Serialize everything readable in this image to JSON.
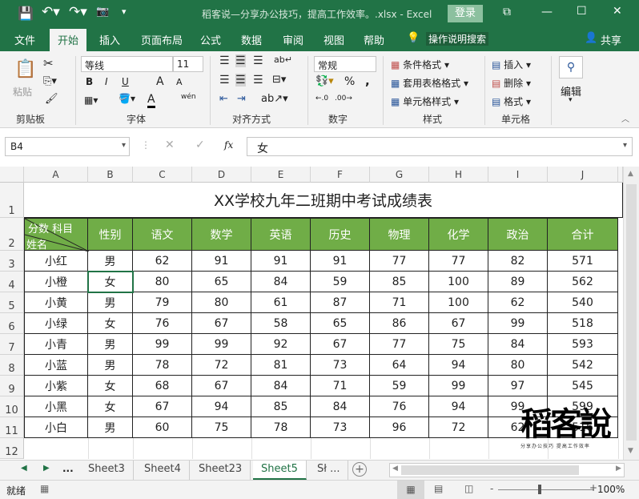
{
  "titlebar": {
    "title": "稻客说—分享办公技巧，提高工作效率。.xlsx  -  Excel",
    "login": "登录",
    "minimize": "—",
    "maximize": "☐",
    "close": "✕",
    "restore": "⧉"
  },
  "menu": {
    "tabs": [
      "文件",
      "开始",
      "插入",
      "页面布局",
      "公式",
      "数据",
      "审阅",
      "视图",
      "帮助"
    ],
    "search": "操作说明搜索",
    "share": "共享"
  },
  "ribbon": {
    "clipboard": {
      "paste": "粘贴",
      "label": "剪贴板"
    },
    "font": {
      "name": "等线",
      "size": "11",
      "bold": "B",
      "italic": "I",
      "underline": "U",
      "label": "字体",
      "grow": "A",
      "shrink": "A",
      "font_color": "A",
      "phonetic": "wén"
    },
    "alignment": {
      "label": "对齐方式"
    },
    "number": {
      "format": "常规",
      "percent": "%",
      "comma": ",",
      "label": "数字"
    },
    "styles": {
      "conditional": "条件格式",
      "table": "套用表格格式",
      "cell": "单元格样式",
      "label": "样式"
    },
    "cells": {
      "insert": "插入",
      "delete": "删除",
      "format": "格式",
      "label": "单元格"
    },
    "editing": {
      "label": "编辑"
    }
  },
  "formula_bar": {
    "name_box": "B4",
    "fx": "fx",
    "value": "女"
  },
  "columns": [
    "A",
    "B",
    "C",
    "D",
    "E",
    "F",
    "G",
    "H",
    "I",
    "J"
  ],
  "rows": [
    "1",
    "2",
    "3",
    "4",
    "5",
    "6",
    "7",
    "8",
    "9",
    "10",
    "11",
    "12"
  ],
  "table": {
    "title": "XX学校九年二班期中考试成绩表",
    "corner": {
      "subject": "分数  科目",
      "name": "姓名"
    },
    "headers": [
      "性别",
      "语文",
      "数学",
      "英语",
      "历史",
      "物理",
      "化学",
      "政治",
      "合计"
    ],
    "data": [
      [
        "小红",
        "男",
        "62",
        "91",
        "91",
        "91",
        "77",
        "77",
        "82",
        "571"
      ],
      [
        "小橙",
        "女",
        "80",
        "65",
        "84",
        "59",
        "85",
        "100",
        "89",
        "562"
      ],
      [
        "小黄",
        "男",
        "79",
        "80",
        "61",
        "87",
        "71",
        "100",
        "62",
        "540"
      ],
      [
        "小绿",
        "女",
        "76",
        "67",
        "58",
        "65",
        "86",
        "67",
        "99",
        "518"
      ],
      [
        "小青",
        "男",
        "99",
        "99",
        "92",
        "67",
        "77",
        "75",
        "84",
        "593"
      ],
      [
        "小蓝",
        "男",
        "78",
        "72",
        "81",
        "73",
        "64",
        "94",
        "80",
        "542"
      ],
      [
        "小紫",
        "女",
        "68",
        "67",
        "84",
        "71",
        "59",
        "99",
        "97",
        "545"
      ],
      [
        "小黑",
        "女",
        "67",
        "94",
        "85",
        "84",
        "76",
        "94",
        "99",
        "599"
      ],
      [
        "小白",
        "男",
        "60",
        "75",
        "78",
        "73",
        "96",
        "72",
        "62",
        "516"
      ]
    ]
  },
  "watermark": {
    "text": "稻客说",
    "sub": "分享办公技巧 提高工作效率"
  },
  "sheets": {
    "more": "...",
    "tabs": [
      "Sheet3",
      "Sheet4",
      "Sheet23",
      "Sheet5",
      "Sł ..."
    ],
    "active": 3,
    "add": "+"
  },
  "status": {
    "ready": "就绪",
    "zoom": "100%",
    "minus": "-",
    "plus": "+"
  },
  "colors": {
    "accent": "#217346",
    "header_fill": "#70ad47"
  }
}
